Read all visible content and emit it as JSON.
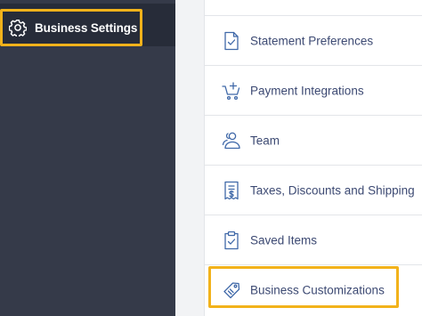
{
  "sidebar": {
    "active_item": {
      "label": "Business Settings",
      "icon": "gear-icon"
    }
  },
  "menu": {
    "items": [
      {
        "label": "Statement Preferences",
        "icon": "document-check-icon"
      },
      {
        "label": "Payment Integrations",
        "icon": "cart-plus-icon"
      },
      {
        "label": "Team",
        "icon": "team-icon"
      },
      {
        "label": "Taxes, Discounts and Shipping",
        "icon": "receipt-icon"
      },
      {
        "label": "Saved Items",
        "icon": "clipboard-check-icon"
      },
      {
        "label": "Business Customizations",
        "icon": "tag-icon"
      }
    ]
  },
  "colors": {
    "sidebar_bg": "#353a49",
    "sidebar_active_bg": "#272c39",
    "highlight": "#f2b21b",
    "menu_text": "#3d4a73",
    "icon_stroke": "#3f68a8"
  }
}
